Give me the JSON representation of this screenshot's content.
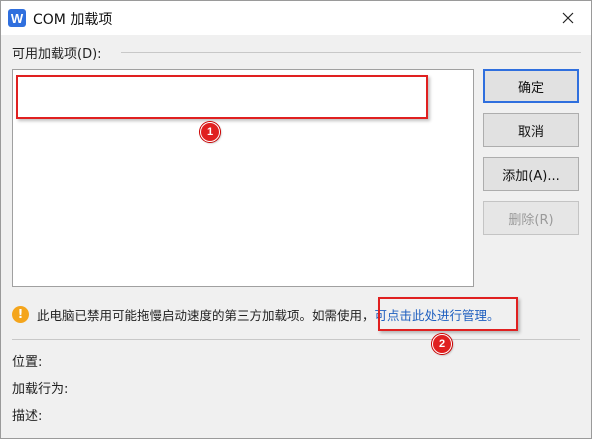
{
  "window": {
    "app_icon_letter": "W",
    "title": "COM 加载项"
  },
  "section": {
    "available_label": "可用加载项(D):"
  },
  "buttons": {
    "ok": "确定",
    "cancel": "取消",
    "add": "添加(A)...",
    "remove": "删除(R)"
  },
  "notice": {
    "text": "此电脑已禁用可能拖慢启动速度的第三方加载项。如需使用，",
    "link": "可点击此处进行管理。"
  },
  "fields": {
    "location": "位置:",
    "load_behavior": "加载行为:",
    "description": "描述:"
  },
  "annotations": {
    "badge_1": "1",
    "badge_2": "2",
    "color": "#e02020"
  },
  "colors": {
    "accent": "#2f6fde",
    "link": "#1f5fbf",
    "warning": "#f4a51c"
  }
}
